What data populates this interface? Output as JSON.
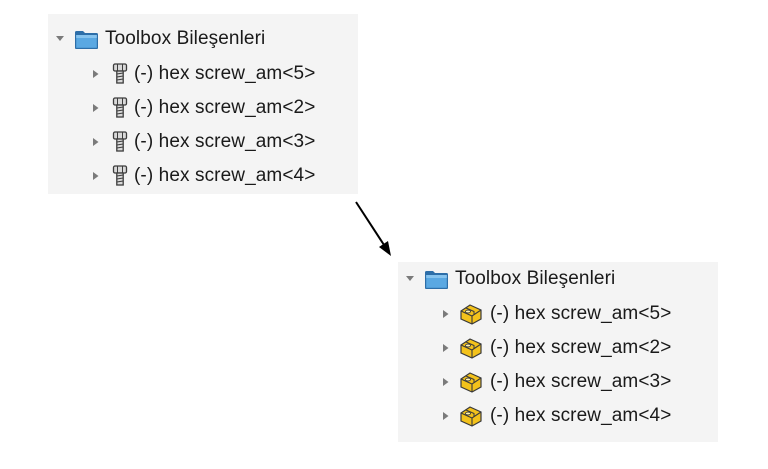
{
  "before": {
    "folder": {
      "label": "Toolbox Bileşenleri",
      "icon": "folder-icon",
      "expanded": true
    },
    "items": [
      {
        "label": "(-) hex screw_am<5>",
        "icon": "screw-icon"
      },
      {
        "label": "(-) hex screw_am<2>",
        "icon": "screw-icon"
      },
      {
        "label": "(-) hex screw_am<3>",
        "icon": "screw-icon"
      },
      {
        "label": "(-) hex screw_am<4>",
        "icon": "screw-icon"
      }
    ]
  },
  "after": {
    "folder": {
      "label": "Toolbox Bileşenleri",
      "icon": "folder-icon",
      "expanded": true
    },
    "items": [
      {
        "label": "(-) hex screw_am<5>",
        "icon": "part-icon"
      },
      {
        "label": "(-) hex screw_am<2>",
        "icon": "part-icon"
      },
      {
        "label": "(-) hex screw_am<3>",
        "icon": "part-icon"
      },
      {
        "label": "(-) hex screw_am<4>",
        "icon": "part-icon"
      }
    ]
  },
  "colors": {
    "panel_bg": "#f4f4f4",
    "folder_fill": "#3b8fd0",
    "part_fill": "#f3c21b",
    "arrow": "#000000"
  }
}
